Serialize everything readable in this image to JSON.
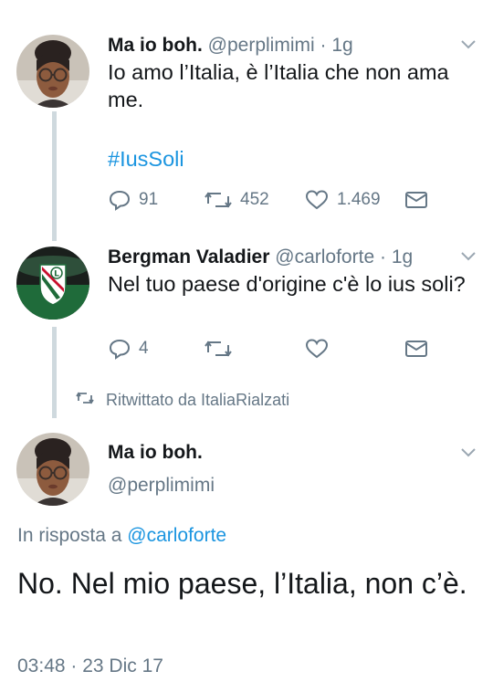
{
  "tweets": [
    {
      "display_name": "Ma io boh.",
      "handle": "@perplimimi",
      "separator": "·",
      "time": "1g",
      "text": "Io amo l’Italia, è l’Italia che non ama me.",
      "hashtag": "#IusSoli",
      "replies": "91",
      "retweets": "452",
      "likes": "1.469"
    },
    {
      "display_name": "Bergman Valadier",
      "handle": "@carloforte",
      "separator": "·",
      "time": "1g",
      "text": "Nel tuo paese d'origine c'è lo ius soli?",
      "replies": "4",
      "retweets": "",
      "likes": ""
    }
  ],
  "retweet_info": "Ritwittato da ItaliaRialzati",
  "main_tweet": {
    "display_name": "Ma io boh.",
    "handle": "@perplimimi",
    "reply_prefix": "In risposta a",
    "reply_mention": "@carloforte",
    "text": "No. Nel mio paese, l’Italia, non c’è.",
    "timestamp": "03:48 · 23 Dic 17"
  },
  "colors": {
    "link_blue": "#1b95e0",
    "secondary_gray": "#657786",
    "thread_line": "#cfd9de",
    "club_green": "#1f6b3a"
  }
}
